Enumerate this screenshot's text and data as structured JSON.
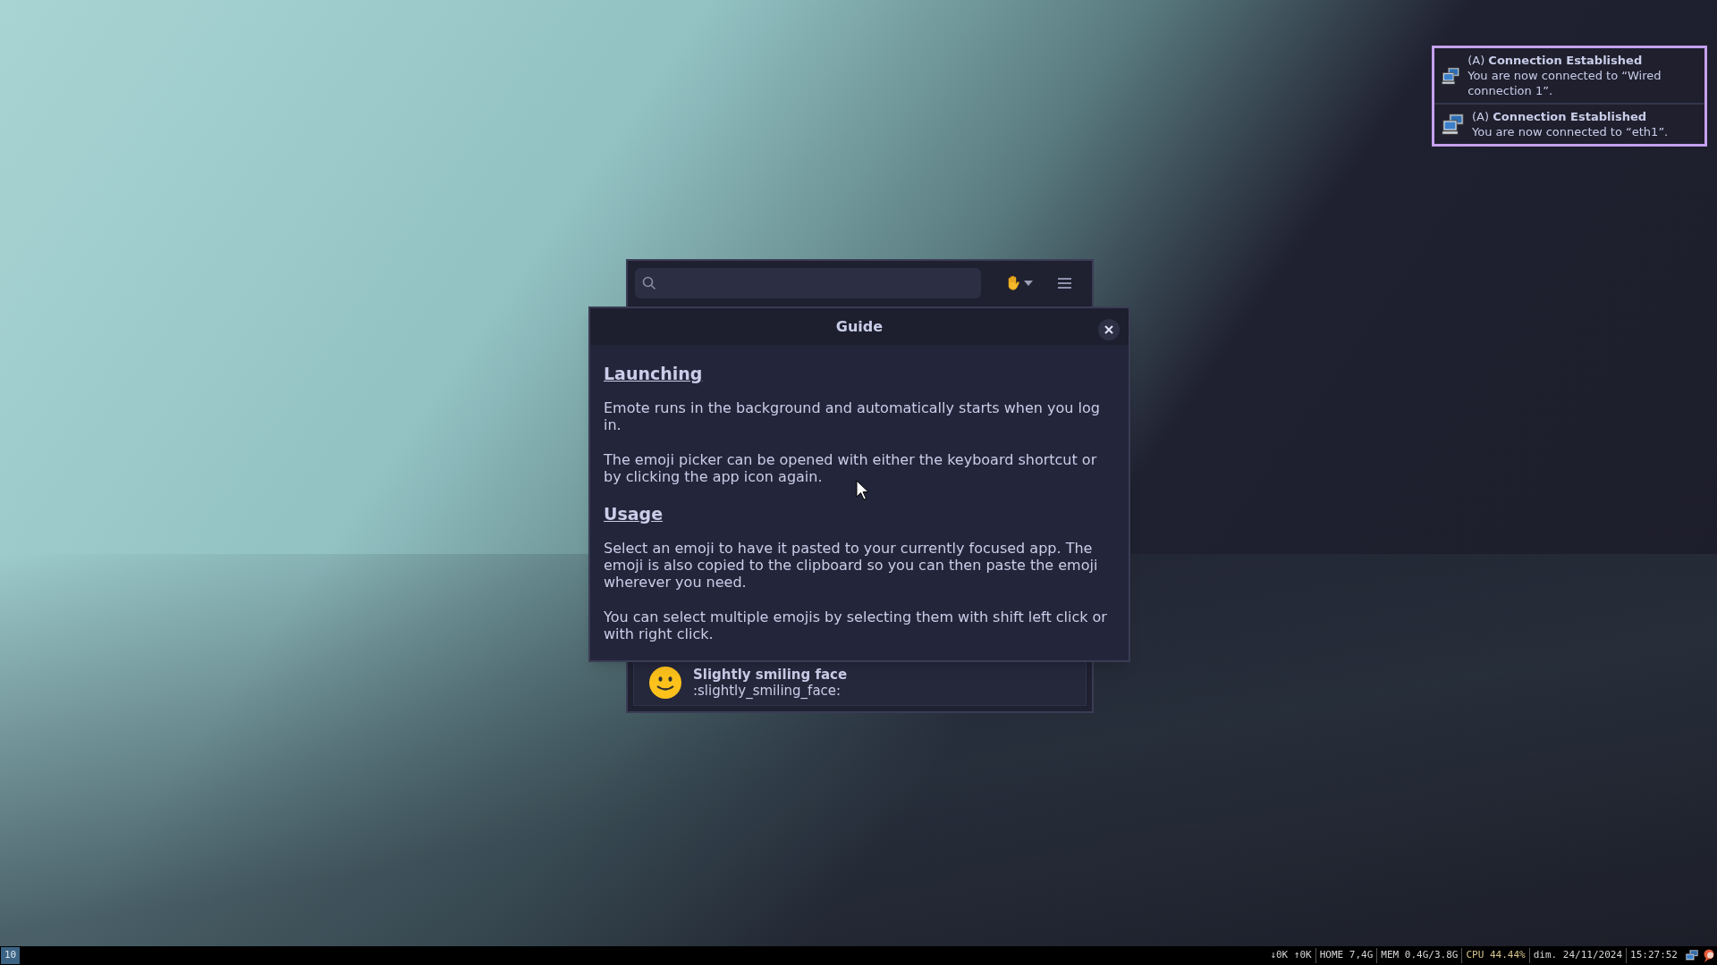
{
  "notifications": [
    {
      "app": "(A)",
      "summary": "Connection Established",
      "body": "You are now connected to “Wired connection 1”."
    },
    {
      "app": "(A)",
      "summary": "Connection Established",
      "body": "You are now connected to “eth1”."
    }
  ],
  "picker": {
    "result": {
      "name": "Slightly smiling face",
      "shortcode": ":slightly_smiling_face:"
    }
  },
  "guide": {
    "title": "Guide",
    "sections": [
      {
        "heading": "Launching",
        "paragraphs": [
          "Emote runs in the background and automatically starts when you log in.",
          "The emoji picker can be opened with either the keyboard shortcut or by clicking the app icon again."
        ]
      },
      {
        "heading": "Usage",
        "paragraphs": [
          "Select an emoji to have it pasted to your currently focused app. The emoji is also copied to the clipboard so you can then paste the emoji wherever you need.",
          "You can select multiple emojis by selecting them with shift left click or with right click."
        ]
      }
    ]
  },
  "taskbar": {
    "workspace": "10",
    "status_items": [
      {
        "text": "↓0K ↑0K",
        "color": "#d4d4d4"
      },
      {
        "text": "HOME 7,4G",
        "color": "#d4d4d4"
      },
      {
        "text": "MEM 0.4G/3.8G",
        "color": "#d4d4d4"
      },
      {
        "text": "CPU 44.44%",
        "color": "#d8c48a"
      },
      {
        "text": "dim. 24/11/2024",
        "color": "#d4d4d4"
      },
      {
        "text": "15:27:52",
        "color": "#d4d4d4"
      }
    ]
  }
}
